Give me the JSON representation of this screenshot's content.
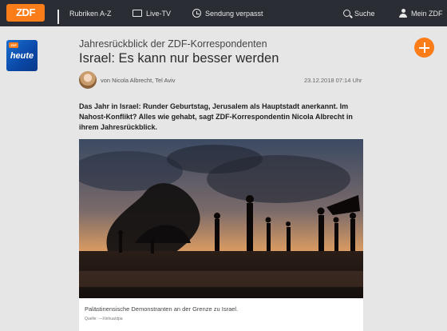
{
  "nav": {
    "logo": "ZDF",
    "items": [
      {
        "label": "Rubriken A-Z",
        "icon": "grid-icon"
      },
      {
        "label": "Live-TV",
        "icon": "tv-icon"
      },
      {
        "label": "Sendung verpasst",
        "icon": "clock-icon"
      },
      {
        "label": "Suche",
        "icon": "search-icon"
      },
      {
        "label": "Mein ZDF",
        "icon": "user-icon"
      }
    ]
  },
  "sidebar": {
    "app_label": "heute",
    "app_badge": "ZDF"
  },
  "article": {
    "kicker": "Jahresrückblick der ZDF-Korrespondenten",
    "title": "Israel: Es kann nur besser werden",
    "byline": "von Nicola Albrecht, Tel Aviv",
    "date": "23.12.2018 07:14 Uhr",
    "teaser": "Das Jahr in Israel: Runder Geburtstag, Jerusalem als Hauptstadt anerkannt. Im Nahost-Konflikt? Alles wie gehabt, sagt ZDF-Korrespondentin Nicola Albrecht in ihrem Jahresrückblick.",
    "image_caption": "Palästinensische Demonstranten an der Grenze zu Israel.",
    "image_source": "Quelle:  —Xinhua/dpa"
  },
  "colors": {
    "accent": "#fa7d19",
    "nav_bg": "#2a2d33",
    "page_bg": "#e6e6e6"
  }
}
